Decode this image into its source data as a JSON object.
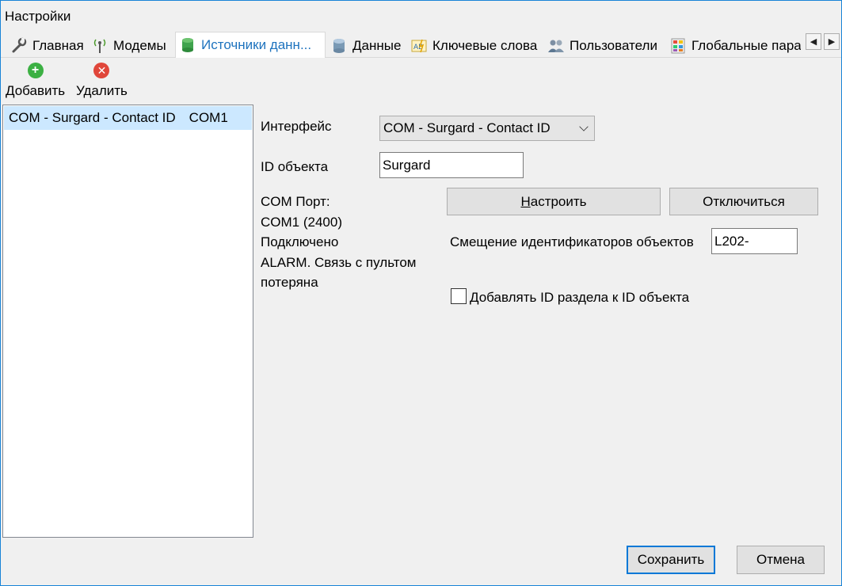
{
  "window": {
    "title": "Настройки"
  },
  "tabs": [
    {
      "label": "Главная",
      "icon": "wrench-icon"
    },
    {
      "label": "Модемы",
      "icon": "antenna-icon"
    },
    {
      "label": "Источники данн...",
      "icon": "database-green-icon",
      "active": true
    },
    {
      "label": "Данные",
      "icon": "database-icon"
    },
    {
      "label": "Ключевые слова",
      "icon": "keywords-icon"
    },
    {
      "label": "Пользователи",
      "icon": "users-icon"
    },
    {
      "label": "Глобальные пара",
      "icon": "grid-icon"
    }
  ],
  "toolbar": {
    "add_label": "Добавить",
    "delete_label": "Удалить"
  },
  "sources": [
    {
      "name": "COM - Surgard - Contact ID",
      "port": "COM1"
    }
  ],
  "form": {
    "interface_label": "Интерфейс",
    "interface_value": "COM - Surgard - Contact ID",
    "object_id_label": "ID объекта",
    "object_id_value": "Surgard",
    "status_lines": [
      "COM Порт:",
      "COM1 (2400)",
      "Подключено",
      "ALARM. Связь с пультом",
      "потеряна"
    ],
    "configure_button_pre": "Н",
    "configure_button_rest": "астроить",
    "disconnect_button": "Отключиться",
    "offset_label": "Смещение идентификаторов объектов",
    "offset_value": "L202-",
    "checkbox_label": "Добавлять ID раздела к ID объекта",
    "checkbox_checked": false
  },
  "footer": {
    "save_label": "Сохранить",
    "cancel_label": "Отмена"
  },
  "colors": {
    "accent": "#0078d7",
    "selection": "#cce8ff",
    "add_green": "#3cb043",
    "delete_red": "#e0463a"
  }
}
